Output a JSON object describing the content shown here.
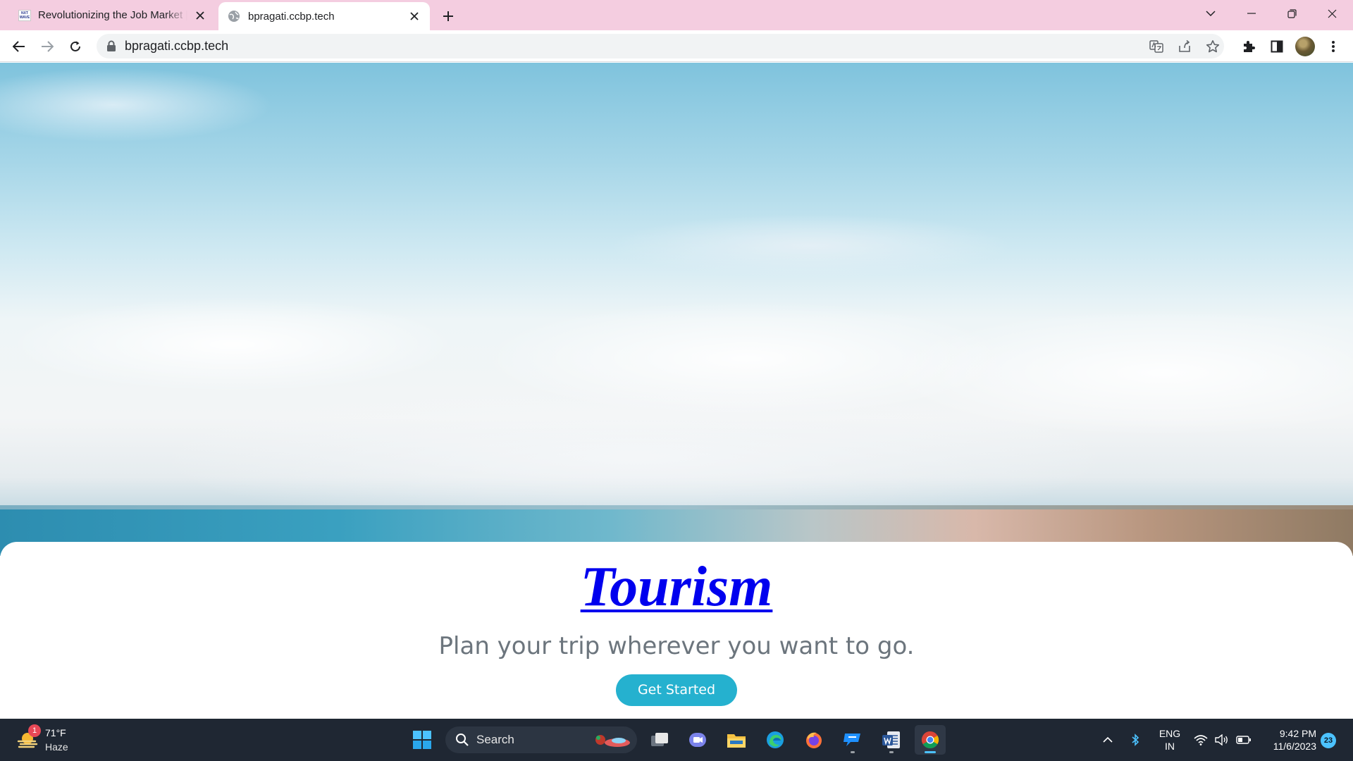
{
  "browser": {
    "tabs": [
      {
        "title": "Revolutionizing the Job Market |",
        "favicon": "nxtwave-logo"
      },
      {
        "title": "bpragati.ccbp.tech",
        "favicon": "globe-icon"
      }
    ],
    "address": "bpragati.ccbp.tech"
  },
  "page": {
    "title": "Tourism",
    "subtitle": "Plan your trip wherever you want to go.",
    "cta_label": "Get Started",
    "colors": {
      "title": "#0000ee",
      "subtitle": "#6c757d",
      "cta": "#25b1cf"
    }
  },
  "taskbar": {
    "weather": {
      "temp": "71°F",
      "condition": "Haze",
      "badge": "1"
    },
    "search_placeholder": "Search",
    "language": {
      "line1": "ENG",
      "line2": "IN"
    },
    "clock": {
      "time": "9:42 PM",
      "date": "11/6/2023"
    },
    "notification_count": "23",
    "colors": {
      "background": "#1f2733",
      "accent": "#4cc2ff"
    }
  }
}
